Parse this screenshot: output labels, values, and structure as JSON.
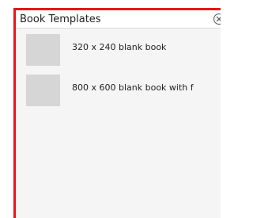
{
  "window": {
    "title": "Book Templates",
    "close_icon": "close-icon"
  },
  "templates": [
    {
      "label": "320 x 240 blank book",
      "thumbnail": "template-thumbnail"
    },
    {
      "label": "800 x 600 blank book with f",
      "thumbnail": "template-thumbnail"
    }
  ],
  "colors": {
    "border_accent": "#e8141b",
    "thumbnail_fill": "#d6d6d6",
    "panel_bg": "#f5f5f5"
  }
}
